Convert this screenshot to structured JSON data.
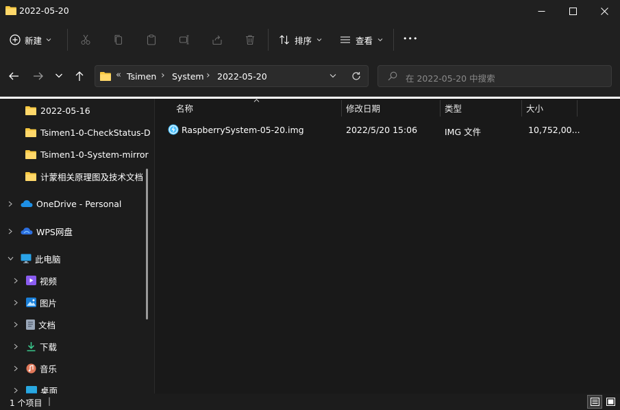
{
  "window": {
    "title": "2022-05-20",
    "minimize_glyph": "—",
    "maximize_glyph": "□",
    "close_glyph": "✕"
  },
  "toolbar": {
    "new_label": "新建",
    "sort_label": "排序",
    "view_label": "查看",
    "more_label": "•••"
  },
  "address": {
    "overflow": "«",
    "crumbs": [
      "Tsimen",
      "System",
      "2022-05-20"
    ],
    "separator": "›"
  },
  "search": {
    "placeholder": "在 2022-05-20 中搜索"
  },
  "nav": {
    "folders": [
      {
        "label": "2022-05-16"
      },
      {
        "label": "Tsimen1-0-CheckStatus-D"
      },
      {
        "label": "Tsimen1-0-System-mirror"
      },
      {
        "label": "计蒙相关原理图及技术文档"
      }
    ],
    "onedrive": "OneDrive - Personal",
    "wps": "WPS网盘",
    "thispc": "此电脑",
    "pc_items": [
      {
        "label": "视频",
        "icon": "video-icon"
      },
      {
        "label": "图片",
        "icon": "picture-icon"
      },
      {
        "label": "文档",
        "icon": "document-icon"
      },
      {
        "label": "下载",
        "icon": "download-icon"
      },
      {
        "label": "音乐",
        "icon": "music-icon"
      },
      {
        "label": "桌面",
        "icon": "desktop-icon"
      }
    ]
  },
  "columns": {
    "name": "名称",
    "modified": "修改日期",
    "type": "类型",
    "size": "大小"
  },
  "files": [
    {
      "name": "RaspberrySystem-05-20.img",
      "modified": "2022/5/20 15:06",
      "type": "IMG 文件",
      "size": "10,752,00..."
    }
  ],
  "status": {
    "count": "1 个项目",
    "divider": "|"
  },
  "colors": {
    "folder": "#f8c840",
    "accent": "#4cc2ff",
    "background": "#1c1c1c",
    "toolbar": "#202020"
  }
}
